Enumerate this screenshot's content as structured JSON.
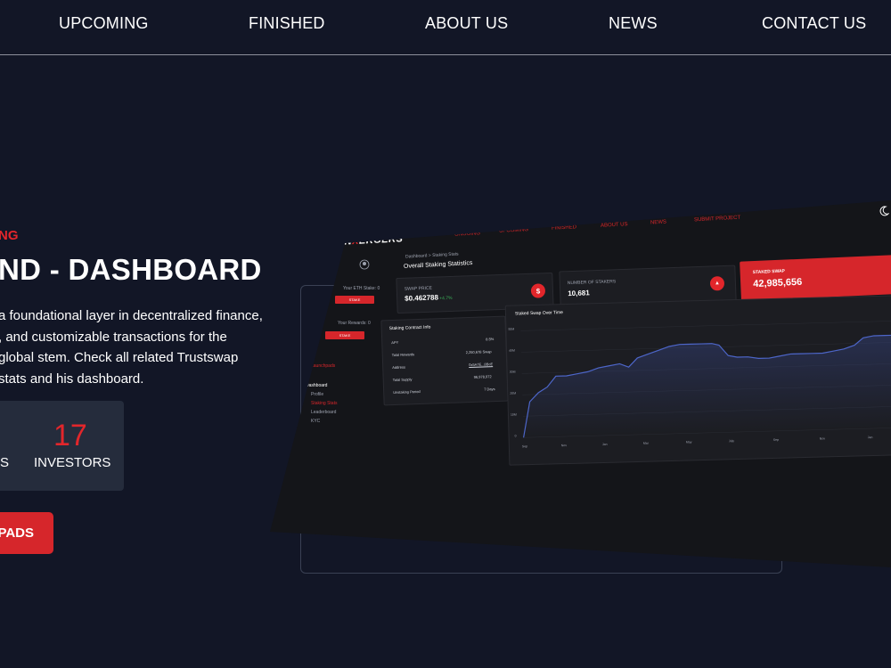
{
  "nav": {
    "items": [
      "UPCOMING",
      "FINISHED",
      "ABOUT US",
      "NEWS",
      "CONTACT US"
    ]
  },
  "hero": {
    "eyebrow": "NG",
    "title": "ND - DASHBOARD",
    "description": "a foundational layer in decentralized finance, , and customizable transactions for the global stem. Check all related Trustswap stats and his dashboard."
  },
  "stats": {
    "left_label": "TS",
    "investors_count": "17",
    "investors_label": "INVESTORS"
  },
  "cta": {
    "label": "PADS"
  },
  "dashboard": {
    "logo_prefix": "IN",
    "logo_x": "X",
    "logo_suffix": "ERGERS",
    "nav": [
      "ONGOING",
      "UPCOMING",
      "FINISHED",
      "ABOUT US",
      "NEWS",
      "SUBMIT PROJECT"
    ],
    "breadcrumb": "Dashboard  >  Staking Stats",
    "page_title": "Overall Staking Statistics",
    "sidebar": {
      "eth_stake_label": "Your ETH Stake: 0",
      "stake_btn": "STAKE",
      "rewards_label": "Your Rewards: 0",
      "stake_btn2": "STAKE",
      "launchpads": "Launchpads",
      "dashboard": "Dashboard",
      "items": [
        "Profile",
        "Staking Stats",
        "Leaderboard",
        "KYC"
      ]
    },
    "cards": {
      "swap_price_label": "SWAP PRICE",
      "swap_price": "$0.462788",
      "swap_change": "+4.7%",
      "stakers_label": "NUMBER OF STAKERS",
      "stakers": "10,681",
      "staked_label": "STAKED SWAP",
      "staked": "42,985,656"
    },
    "contract": {
      "title": "Staking Contract Info",
      "rows": [
        {
          "k": "APY",
          "v": "8.5%"
        },
        {
          "k": "Total Rewards",
          "v": "2,250,678 Swap"
        },
        {
          "k": "Address",
          "v": "0x5A7E...8BcE"
        },
        {
          "k": "Total Supply",
          "v": "96,978,972"
        },
        {
          "k": "Unstaking Period",
          "v": "7 Days"
        }
      ]
    },
    "chart": {
      "title": "Staked Swap Over Time",
      "yticks": [
        "50M",
        "40M",
        "30M",
        "20M",
        "10M",
        "0"
      ],
      "xticks": [
        "Sep",
        "Nov",
        "Jan",
        "Mar",
        "May",
        "July",
        "Sep",
        "Nov",
        "Jan"
      ]
    }
  }
}
